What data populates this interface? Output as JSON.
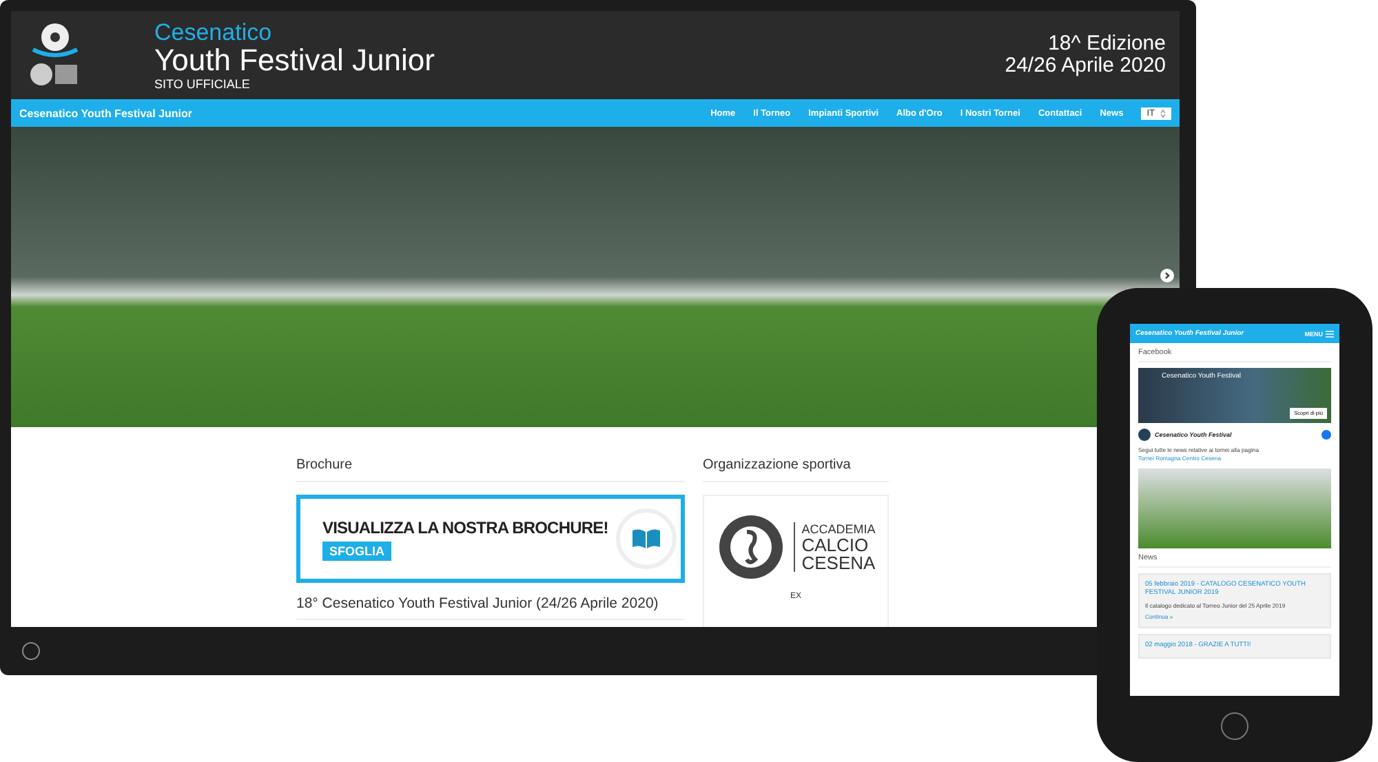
{
  "site": {
    "kicker": "Cesenatico",
    "title": "Youth Festival Junior",
    "subtitle": "SITO UFFICIALE",
    "edition": "18^ Edizione",
    "dates": "24/26 Aprile 2020"
  },
  "nav": {
    "brand": "Cesenatico Youth Festival Junior",
    "items": [
      "Home",
      "Il Torneo",
      "Impianti Sportivi",
      "Albo d'Oro",
      "I Nostri Tornei",
      "Contattaci",
      "News"
    ],
    "language": "IT"
  },
  "brochure": {
    "heading": "Brochure",
    "banner_title": "VISUALIZZA LA NOSTRA BROCHURE!",
    "banner_button": "SFOGLIA",
    "caption": "18° Cesenatico Youth Festival Junior (24/26 Aprile 2020)"
  },
  "organization": {
    "heading": "Organizzazione sportiva",
    "logo_lines": [
      "ACCADEMIA",
      "CALCIO",
      "CESENA"
    ],
    "ex_label": "EX"
  },
  "phone": {
    "brand": "Cesenatico Youth Festival Junior",
    "menu": "MENU",
    "facebook_heading": "Facebook",
    "page_name": "Cesenatico Youth Festival",
    "cover_button": "Scopri di più",
    "post_author": "Cesenatico Youth Festival",
    "post_text": "Segui tutte le news relative ai tornei alla pagina ",
    "post_link": "Tornei Romagna Centro Cesena",
    "news_heading": "News",
    "news": [
      {
        "title": "05 febbraio 2019 - CATALOGO CESENATICO YOUTH FESTIVAL JUNIOR 2019",
        "summary": "Il catalogo dedicato al Torneo Junior del 25 Aprile 2019",
        "more": "Continua »"
      },
      {
        "title": "02 maggio 2018 - GRAZIE A TUTTI!"
      }
    ]
  }
}
